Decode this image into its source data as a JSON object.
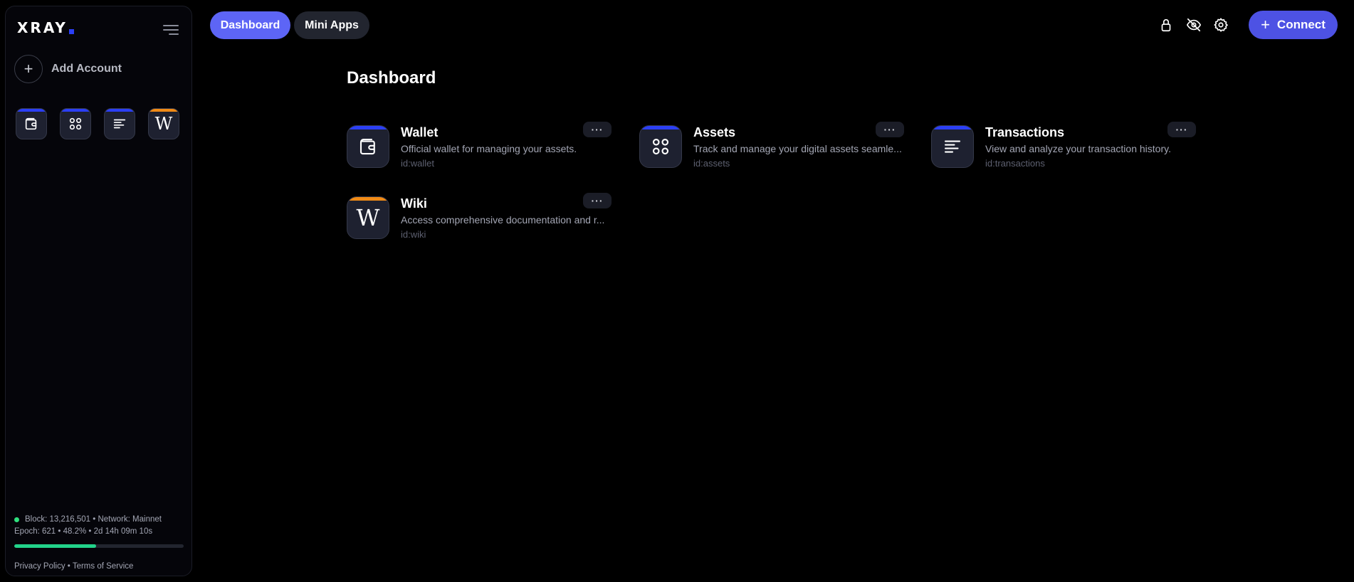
{
  "brand": {
    "name": "XRAY",
    "accent": "#2b3ff5"
  },
  "sidebar": {
    "add_account_label": "Add Account",
    "quick_apps": [
      {
        "name": "Wallet",
        "icon": "wallet-icon",
        "accent": "#2b3ff5"
      },
      {
        "name": "Assets",
        "icon": "grid-icon",
        "accent": "#2b3ff5"
      },
      {
        "name": "Transactions",
        "icon": "list-icon",
        "accent": "#2b3ff5"
      },
      {
        "name": "Wiki",
        "icon": "wiki-icon",
        "accent": "#f08a16"
      }
    ],
    "status": {
      "line1": "Block: 13,216,501 • Network: Mainnet",
      "line2": "Epoch: 621 • 48.2% • 2d 14h 09m 10s",
      "epoch_progress": 0.482,
      "indicator_color": "#2fe07d"
    },
    "legal": {
      "privacy": "Privacy Policy",
      "separator": "•",
      "terms": "Terms of Service"
    }
  },
  "header": {
    "tabs": [
      {
        "label": "Dashboard",
        "active": true
      },
      {
        "label": "Mini Apps",
        "active": false
      }
    ],
    "icons": [
      "lock-icon",
      "eye-off-icon",
      "gear-icon"
    ],
    "connect_label": "Connect"
  },
  "main": {
    "title": "Dashboard",
    "apps": [
      {
        "title": "Wallet",
        "description": "Official wallet for managing your assets.",
        "id": "id:wallet",
        "icon": "wallet-icon",
        "accent": "#2b3ff5",
        "more": "···"
      },
      {
        "title": "Assets",
        "description": "Track and manage your digital assets seamle...",
        "id": "id:assets",
        "icon": "grid-icon",
        "accent": "#2b3ff5",
        "more": "···"
      },
      {
        "title": "Transactions",
        "description": "View and analyze your transaction history.",
        "id": "id:transactions",
        "icon": "list-icon",
        "accent": "#2b3ff5",
        "more": "···"
      },
      {
        "title": "Wiki",
        "description": "Access comprehensive documentation and r...",
        "id": "id:wiki",
        "icon": "wiki-icon",
        "accent": "#f08a16",
        "more": "···"
      }
    ]
  }
}
